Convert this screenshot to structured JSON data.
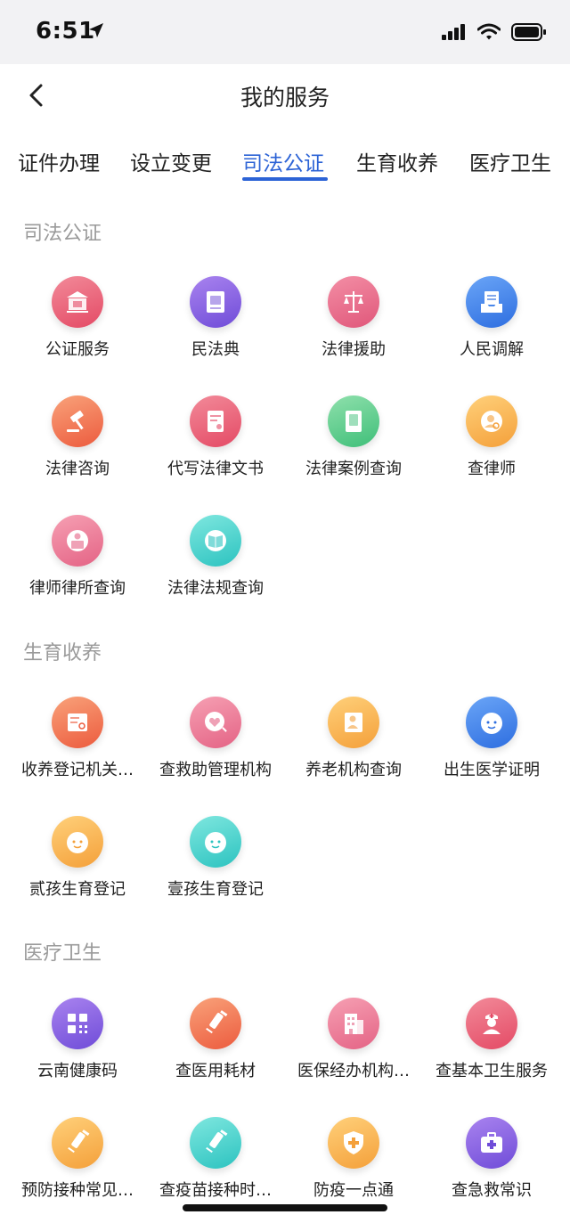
{
  "status": {
    "time": "6:51"
  },
  "nav": {
    "title": "我的服务"
  },
  "tabs": [
    "证件办理",
    "设立变更",
    "司法公证",
    "生育收养",
    "医疗卫生"
  ],
  "sections": [
    {
      "title": "司法公证",
      "items": [
        {
          "label": "公证服务",
          "icon": "courthouse-icon"
        },
        {
          "label": "民法典",
          "icon": "law-book-icon"
        },
        {
          "label": "法律援助",
          "icon": "scales-icon"
        },
        {
          "label": "人民调解",
          "icon": "document-tray-icon"
        },
        {
          "label": "法律咨询",
          "icon": "gavel-icon"
        },
        {
          "label": "代写法律文书",
          "icon": "document-icon"
        },
        {
          "label": "法律案例查询",
          "icon": "case-book-icon"
        },
        {
          "label": "查律师",
          "icon": "lawyer-search-icon"
        },
        {
          "label": "律师律所查询",
          "icon": "law-firm-icon"
        },
        {
          "label": "法律法规查询",
          "icon": "open-book-icon"
        }
      ]
    },
    {
      "title": "生育收养",
      "items": [
        {
          "label": "收养登记机关…",
          "icon": "adoption-card-icon"
        },
        {
          "label": "查救助管理机构",
          "icon": "heart-search-icon"
        },
        {
          "label": "养老机构查询",
          "icon": "elder-search-icon"
        },
        {
          "label": "出生医学证明",
          "icon": "baby-face-icon"
        },
        {
          "label": "贰孩生育登记",
          "icon": "baby-face-icon"
        },
        {
          "label": "壹孩生育登记",
          "icon": "baby-face-icon"
        }
      ]
    },
    {
      "title": "医疗卫生",
      "items": [
        {
          "label": "云南健康码",
          "icon": "qr-code-icon"
        },
        {
          "label": "查医用耗材",
          "icon": "syringe-icon"
        },
        {
          "label": "医保经办机构…",
          "icon": "hospital-building-icon"
        },
        {
          "label": "查基本卫生服务",
          "icon": "nurse-icon"
        },
        {
          "label": "预防接种常见…",
          "icon": "syringe-icon"
        },
        {
          "label": "查疫苗接种时…",
          "icon": "syringe-icon"
        },
        {
          "label": "防疫一点通",
          "icon": "shield-cross-icon"
        },
        {
          "label": "查急救常识",
          "icon": "first-aid-kit-icon"
        }
      ]
    }
  ],
  "colors": {
    "accent": "#2c63d6",
    "section_title": "#9a9a9a"
  }
}
